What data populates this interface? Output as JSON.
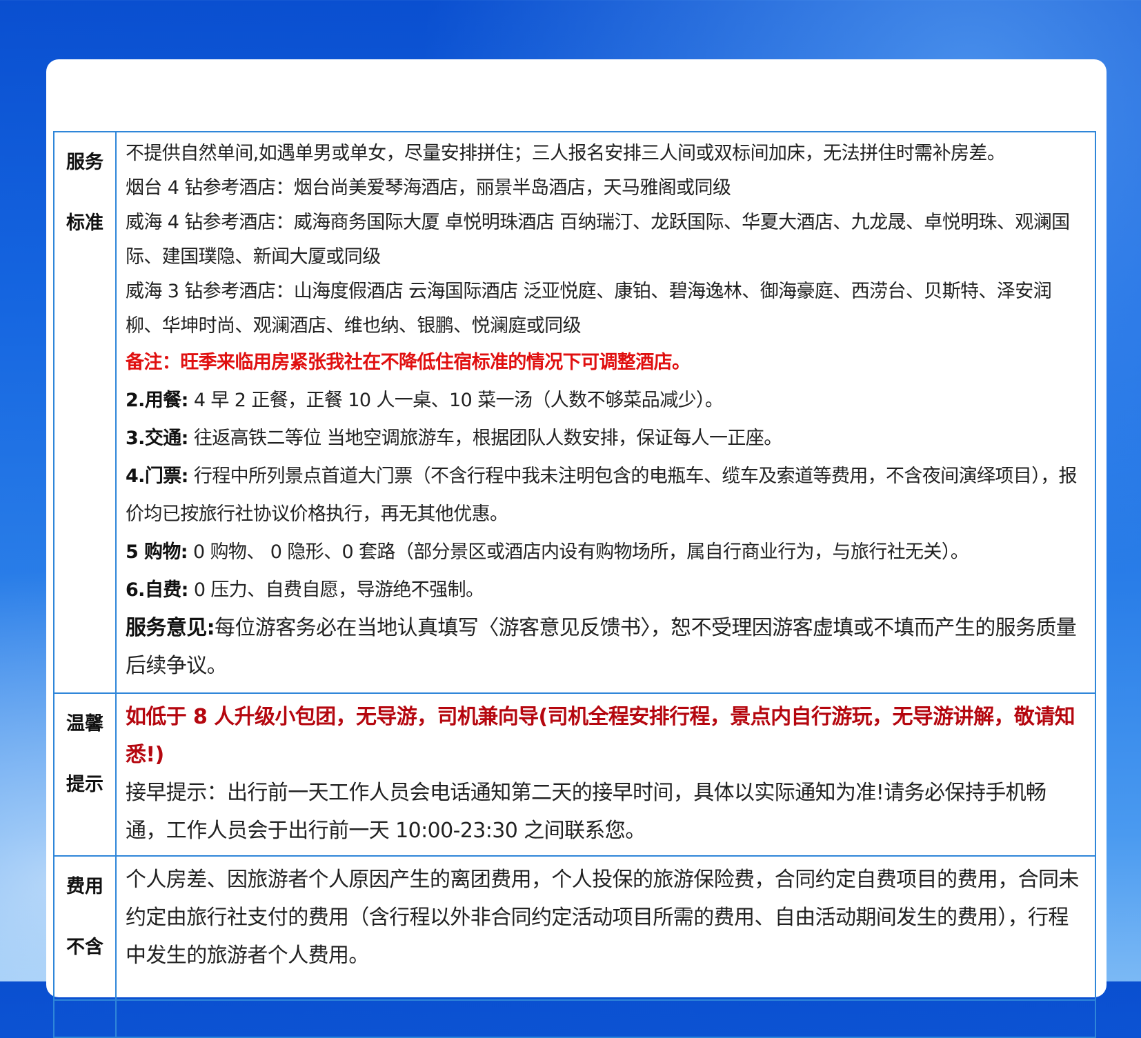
{
  "service": {
    "label": [
      "服务",
      "标准"
    ],
    "lines": [
      "不提供自然单间,如遇单男或单女，尽量安排拼住；三人报名安排三人间或双标间加床，无法拼住时需补房差。",
      "烟台 4 钻参考酒店：烟台尚美爱琴海酒店，丽景半岛酒店，天马雅阁或同级",
      "威海 4 钻参考酒店：威海商务国际大厦  卓悦明珠酒店  百纳瑞汀、龙跃国际、华夏大酒店、九龙晟、卓悦明珠、观澜国际、建国璞隐、新闻大厦或同级",
      "威海 3 钻参考酒店：山海度假酒店  云海国际酒店  泛亚悦庭、康铂、碧海逸林、御海豪庭、西涝台、贝斯特、泽安润柳、华坤时尚、观澜酒店、维也纳、银鹏、悦澜庭或同级"
    ],
    "note": "备注：旺季来临用房紧张我社在不降低住宿标准的情况下可调整酒店。",
    "items": [
      {
        "key": "2.用餐:",
        "text": " 4 早 2 正餐，正餐 10 人一桌、10 菜一汤（人数不够菜品减少）。"
      },
      {
        "key": "3.交通:",
        "text": " 往返高铁二等位  当地空调旅游车，根据团队人数安排，保证每人一正座。"
      },
      {
        "key": "4.门票:",
        "text": " 行程中所列景点首道大门票（不含行程中我未注明包含的电瓶车、缆车及索道等费用，不含夜间演绎项目），报价均已按旅行社协议价格执行，再无其他优惠。"
      },
      {
        "key": "5 购物:",
        "text": " 0 购物、  0 隐形、0 套路（部分景区或酒店内设有购物场所，属自行商业行为，与旅行社无关）。"
      },
      {
        "key": "6.自费:",
        "text": " 0 压力、自费自愿，导游绝不强制。"
      }
    ],
    "opinion_key": "服务意见:",
    "opinion_text": "每位游客务必在当地认真填写〈游客意见反馈书〉，恕不受理因游客虚填或不填而产生的服务质量后续争议。"
  },
  "tips": {
    "label": [
      "温馨",
      "提示"
    ],
    "highlight": "如低于 8 人升级小包团，无导游，司机兼向导(司机全程安排行程，景点内自行游玩，无导游讲解，敬请知悉!)",
    "pickup": "接早提示：出行前一天工作人员会电话通知第二天的接早时间，具体以实际通知为准!请务必保持手机畅通，工作人员会于出行前一天 10:00-23:30 之间联系您。"
  },
  "fee": {
    "label": [
      "费用",
      "不含"
    ],
    "text": "个人房差、因旅游者个人原因产生的离团费用，个人投保的旅游保险费，合同约定自费项目的费用，合同未约定由旅行社支付的费用（含行程以外非合同约定活动项目所需的费用、自由活动期间发生的费用），行程中发生的旅游者个人费用。"
  }
}
